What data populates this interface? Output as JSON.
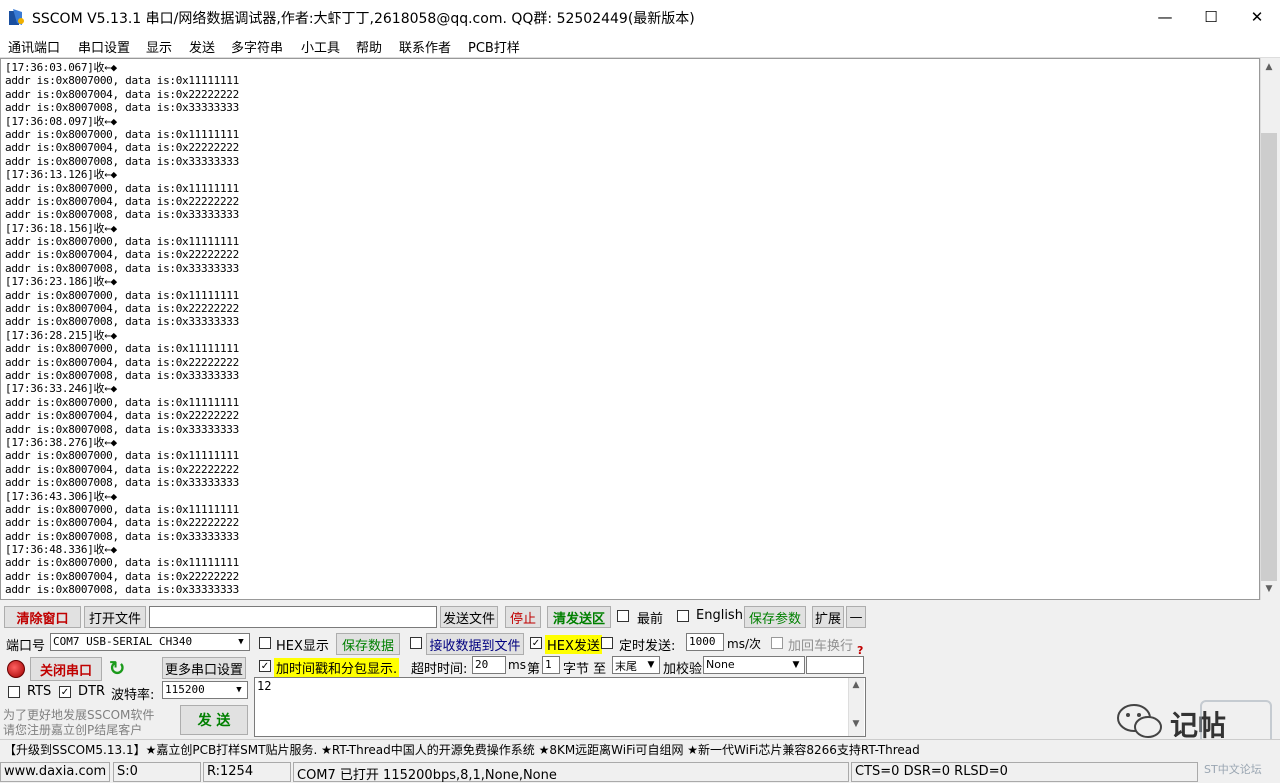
{
  "window": {
    "title": "SSCOM V5.13.1 串口/网络数据调试器,作者:大虾丁丁,2618058@qq.com. QQ群: 52502449(最新版本)",
    "minimize": "—",
    "maximize": "☐",
    "close": "✕"
  },
  "menu": [
    "通讯端口",
    "串口设置",
    "显示",
    "发送",
    "多字符串",
    "小工具",
    "帮助",
    "联系作者",
    "PCB打样"
  ],
  "receive_lines": [
    "[17:36:03.067]收←◆",
    "addr is:0x8007000, data is:0x11111111",
    "addr is:0x8007004, data is:0x22222222",
    "addr is:0x8007008, data is:0x33333333",
    "[17:36:08.097]收←◆",
    "addr is:0x8007000, data is:0x11111111",
    "addr is:0x8007004, data is:0x22222222",
    "addr is:0x8007008, data is:0x33333333",
    "[17:36:13.126]收←◆",
    "addr is:0x8007000, data is:0x11111111",
    "addr is:0x8007004, data is:0x22222222",
    "addr is:0x8007008, data is:0x33333333",
    "[17:36:18.156]收←◆",
    "addr is:0x8007000, data is:0x11111111",
    "addr is:0x8007004, data is:0x22222222",
    "addr is:0x8007008, data is:0x33333333",
    "[17:36:23.186]收←◆",
    "addr is:0x8007000, data is:0x11111111",
    "addr is:0x8007004, data is:0x22222222",
    "addr is:0x8007008, data is:0x33333333",
    "[17:36:28.215]收←◆",
    "addr is:0x8007000, data is:0x11111111",
    "addr is:0x8007004, data is:0x22222222",
    "addr is:0x8007008, data is:0x33333333",
    "[17:36:33.246]收←◆",
    "addr is:0x8007000, data is:0x11111111",
    "addr is:0x8007004, data is:0x22222222",
    "addr is:0x8007008, data is:0x33333333",
    "[17:36:38.276]收←◆",
    "addr is:0x8007000, data is:0x11111111",
    "addr is:0x8007004, data is:0x22222222",
    "addr is:0x8007008, data is:0x33333333",
    "[17:36:43.306]收←◆",
    "addr is:0x8007000, data is:0x11111111",
    "addr is:0x8007004, data is:0x22222222",
    "addr is:0x8007008, data is:0x33333333",
    "[17:36:48.336]收←◆",
    "addr is:0x8007000, data is:0x11111111",
    "addr is:0x8007004, data is:0x22222222",
    "addr is:0x8007008, data is:0x33333333"
  ],
  "toolbar": {
    "clear_window": "清除窗口",
    "open_file": "打开文件",
    "file_path": "",
    "send_file": "发送文件",
    "stop": "停止",
    "clear_send": "清发送区",
    "topmost": "最前",
    "english": "English",
    "save_params": "保存参数",
    "expand": "扩展",
    "collapse": "—"
  },
  "port": {
    "port_label": "端口号",
    "port_value": "COM7 USB-SERIAL CH340",
    "close_port": "关闭串口",
    "more_settings": "更多串口设置",
    "rts": "RTS",
    "dtr": "DTR",
    "baud_label": "波特率:",
    "baud_value": "115200",
    "promo_line1": "为了更好地发展SSCOM软件",
    "promo_line2": "请您注册嘉立创P结尾客户",
    "send": "发 送"
  },
  "options": {
    "hex_display": "HEX显示",
    "save_data": "保存数据",
    "recv_to_file": "接收数据到文件",
    "hex_send": "HEX发送",
    "timed_send": "定时发送:",
    "interval": "1000",
    "interval_unit": "ms/次",
    "add_crlf": "加回车换行",
    "timestamp": "加时间戳和分包显示.",
    "timeout_label": "超时时间:",
    "timeout_value": "20",
    "timeout_unit": "ms",
    "frame_label": "第",
    "frame_value": "1",
    "byte_label": "字节 至",
    "end_value": "末尾",
    "checksum_label": "加校验",
    "checksum_value": "None",
    "help": "?"
  },
  "send_text": "12",
  "ad_bar": "【升级到SSCOM5.13.1】★嘉立创PCB打样SMT贴片服务. ★RT-Thread中国人的开源免费操作系统 ★8KM远距离WiFi可自组网 ★新一代WiFi芯片兼容8266支持RT-Thread",
  "statusbar": {
    "website": "www.daxia.com",
    "sent": "S:0",
    "received": "R:1254",
    "port_status": "COM7 已打开  115200bps,8,1,None,None",
    "lines": "CTS=0 DSR=0 RLSD=0"
  },
  "watermark": {
    "text": "记帖",
    "sub": "ST中文论坛"
  },
  "colors": {
    "red_button_text": "#c00000",
    "green_button_text": "#008000",
    "highlight_yellow": "#ffff00"
  }
}
